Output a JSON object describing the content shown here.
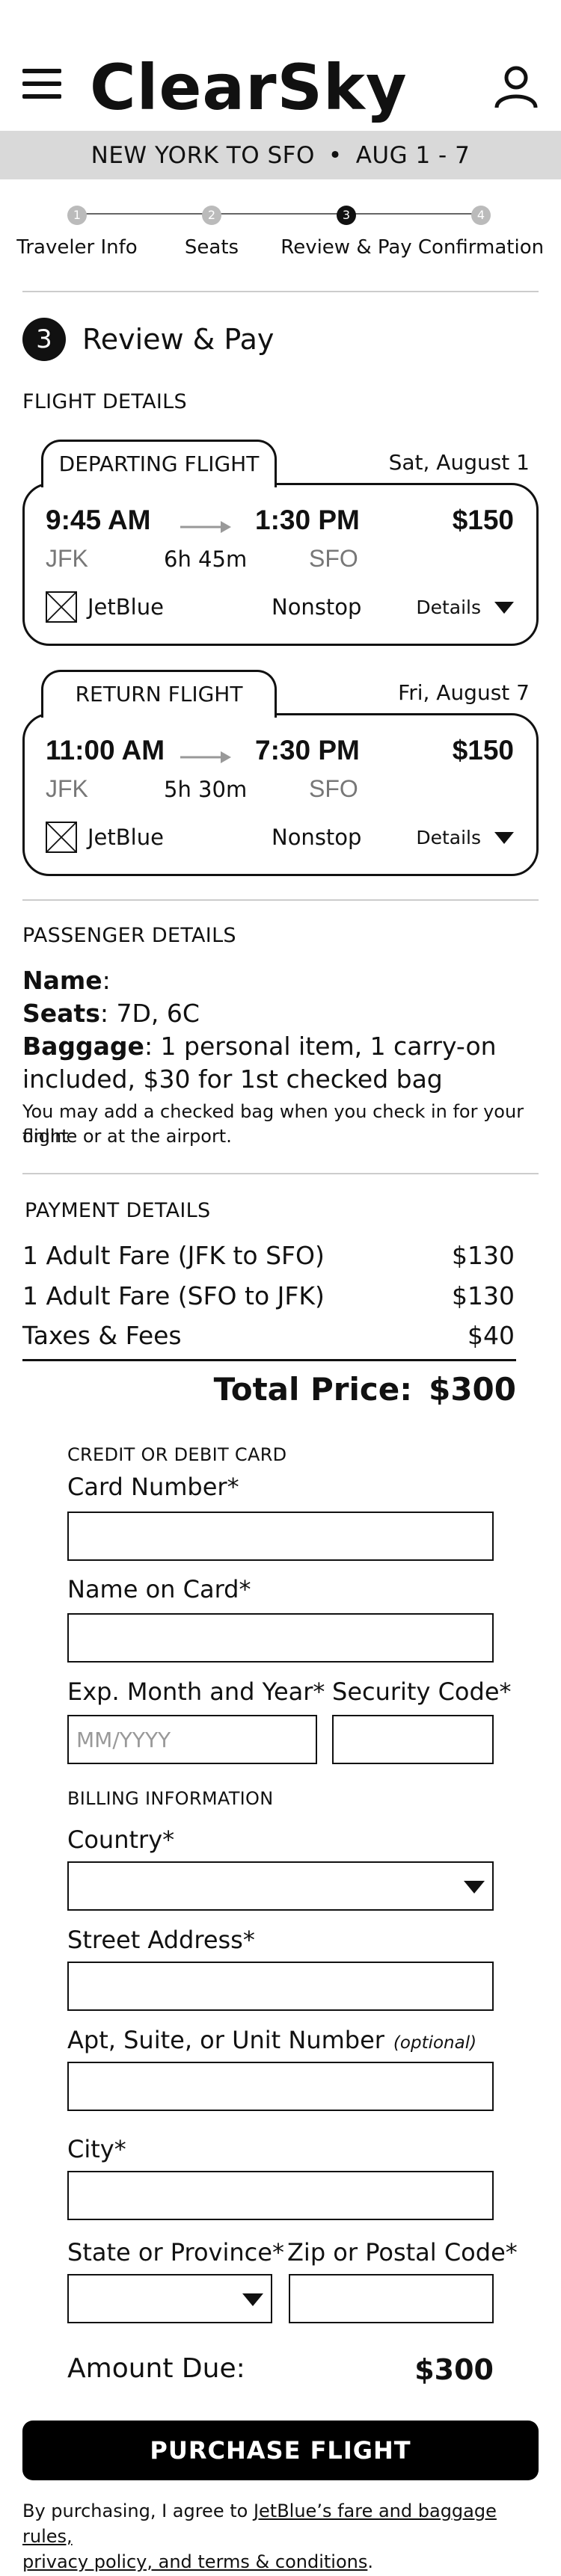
{
  "app": {
    "logo": "ClearSky",
    "menu_icon": "hamburger-menu-icon",
    "user_icon": "user-account-icon"
  },
  "route_bar": {
    "route": "NEW YORK TO SFO",
    "separator": "•",
    "dates": "AUG 1 - 7"
  },
  "stepper": {
    "steps": [
      {
        "num": "1",
        "label": "Traveler Info",
        "state": "done"
      },
      {
        "num": "2",
        "label": "Seats",
        "state": "done"
      },
      {
        "num": "3",
        "label": "Review & Pay",
        "state": "current"
      },
      {
        "num": "4",
        "label": "Confirmation",
        "state": "upcoming"
      }
    ]
  },
  "section": {
    "number": "3",
    "title": "Review & Pay"
  },
  "flight_details": {
    "heading": "FLIGHT DETAILS",
    "flights": [
      {
        "tab": "DEPARTING FLIGHT",
        "date": "Sat, August 1",
        "depart_time": "9:45 AM",
        "arrive_time": "1:30 PM",
        "price": "$150",
        "from": "JFK",
        "duration": "6h 45m",
        "to": "SFO",
        "airline": "JetBlue",
        "stops": "Nonstop",
        "details_label": "Details"
      },
      {
        "tab": "RETURN FLIGHT",
        "date": "Fri, August 7",
        "depart_time": "11:00 AM",
        "arrive_time": "7:30 PM",
        "price": "$150",
        "from": "JFK",
        "duration": "5h 30m",
        "to": "SFO",
        "airline": "JetBlue",
        "stops": "Nonstop",
        "details_label": "Details"
      }
    ]
  },
  "passenger": {
    "heading": "PASSENGER DETAILS",
    "name_label": "Name",
    "name_value": "",
    "seats_label": "Seats",
    "seats_value": "7D, 6C",
    "baggage_label": "Baggage",
    "baggage_line1": "1 personal item, 1 carry-on",
    "baggage_line2": "included, $30 for 1st checked bag",
    "note_line1": "You may add a checked bag when you check in for your flight",
    "note_line2": "online or at the airport."
  },
  "payment": {
    "heading": "PAYMENT DETAILS",
    "rows": [
      {
        "label": "1 Adult Fare (JFK to SFO)",
        "amount": "$130"
      },
      {
        "label": "1 Adult Fare (SFO to JFK)",
        "amount": "$130"
      },
      {
        "label": "Taxes & Fees",
        "amount": "$40"
      }
    ],
    "total_label": "Total Price:",
    "total_amount": "$300"
  },
  "form": {
    "card_heading": "CREDIT OR DEBIT CARD",
    "card_number_label": "Card Number*",
    "card_number_value": "",
    "name_on_card_label": "Name on Card*",
    "name_on_card_value": "",
    "exp_label": "Exp. Month and Year*",
    "exp_placeholder": "MM/YYYY",
    "cvv_label": "Security Code*",
    "cvv_value": "",
    "billing_heading": "BILLING INFORMATION",
    "country_label": "Country*",
    "country_value": "",
    "street_label": "Street Address*",
    "street_value": "",
    "apt_label": "Apt, Suite, or Unit Number",
    "apt_optional": "(optional)",
    "apt_value": "",
    "city_label": "City*",
    "city_value": "",
    "state_label": "State or Province*",
    "state_value": "",
    "zip_label": "Zip or Postal Code*",
    "zip_value": ""
  },
  "amount_due": {
    "label": "Amount Due:",
    "value": "$300"
  },
  "purchase_button": "PURCHASE FLIGHT",
  "legal": {
    "prefix": "By purchasing, I agree to ",
    "link_line1": "JetBlue’s fare and baggage rules,",
    "link_line2": "privacy policy, and terms & conditions",
    "suffix": "."
  }
}
